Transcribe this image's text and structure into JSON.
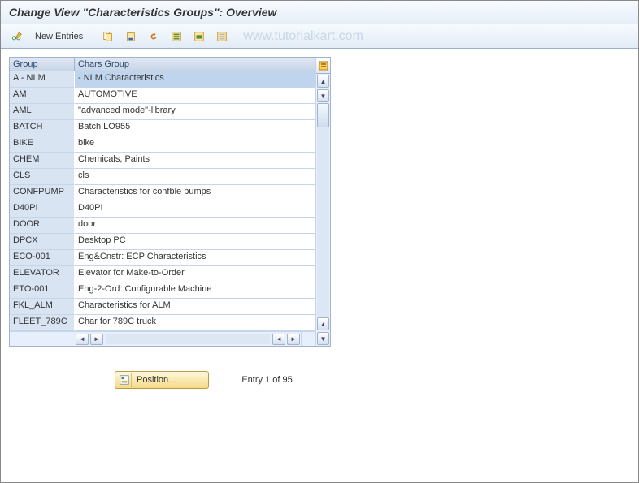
{
  "window": {
    "title": "Change View \"Characteristics Groups\": Overview"
  },
  "toolbar": {
    "new_entries_label": "New Entries"
  },
  "watermark": "www.tutorialkart.com",
  "table": {
    "columns": {
      "group": "Group",
      "chars_group": "Chars Group"
    },
    "rows": [
      {
        "group": "A - NLM",
        "chars": "- NLM Characteristics",
        "selected": true
      },
      {
        "group": "AM",
        "chars": "AUTOMOTIVE"
      },
      {
        "group": "AML",
        "chars": "\"advanced mode\"-library"
      },
      {
        "group": "BATCH",
        "chars": "Batch LO955"
      },
      {
        "group": "BIKE",
        "chars": "bike"
      },
      {
        "group": "CHEM",
        "chars": "Chemicals, Paints"
      },
      {
        "group": "CLS",
        "chars": "cls"
      },
      {
        "group": "CONFPUMP",
        "chars": "Characteristics for confble pumps"
      },
      {
        "group": "D40PI",
        "chars": "D40PI"
      },
      {
        "group": "DOOR",
        "chars": "door"
      },
      {
        "group": "DPCX",
        "chars": "Desktop PC"
      },
      {
        "group": "ECO-001",
        "chars": "Eng&Cnstr: ECP Characteristics"
      },
      {
        "group": "ELEVATOR",
        "chars": "Elevator for Make-to-Order"
      },
      {
        "group": "ETO-001",
        "chars": "Eng-2-Ord: Configurable Machine"
      },
      {
        "group": "FKL_ALM",
        "chars": "Characteristics for ALM"
      },
      {
        "group": "FLEET_789C",
        "chars": "Char for 789C truck"
      }
    ]
  },
  "footer": {
    "position_label": "Position...",
    "entry_status": "Entry 1 of 95"
  }
}
